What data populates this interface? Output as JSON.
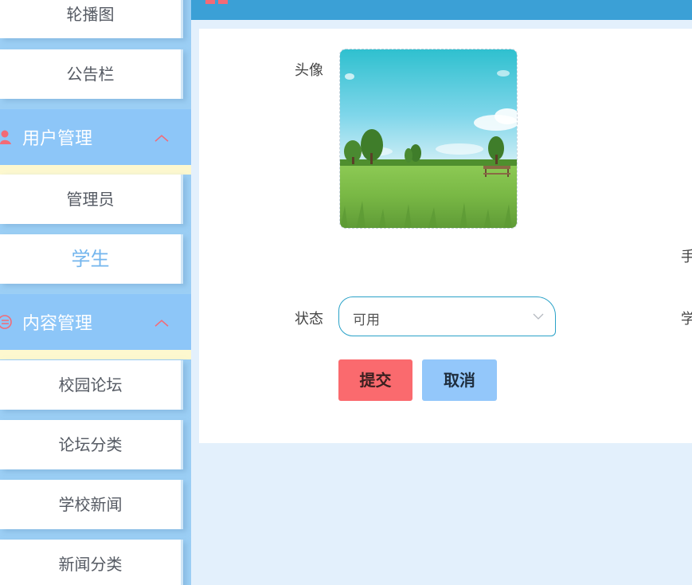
{
  "sidebar": {
    "items_top": [
      {
        "label": "轮播图"
      },
      {
        "label": "公告栏"
      }
    ],
    "group_user": {
      "label": "用户管理",
      "icon": "user-icon",
      "items": [
        {
          "label": "管理员"
        },
        {
          "label": "学生"
        }
      ]
    },
    "group_content": {
      "label": "内容管理",
      "icon": "list-icon",
      "items": [
        {
          "label": "校园论坛"
        },
        {
          "label": "论坛分类"
        },
        {
          "label": "学校新闻"
        },
        {
          "label": "新闻分类"
        }
      ]
    },
    "active_item": "学生"
  },
  "form": {
    "avatar_label": "头像",
    "status_label": "状态",
    "status_value": "可用",
    "right_label_1": "手",
    "right_label_2": "学",
    "submit_label": "提交",
    "cancel_label": "取消"
  },
  "colors": {
    "topbar": "#3ba0d6",
    "sidebar": "#9ccff5",
    "group_head": "#8dc6f8",
    "submit": "#fa6a6e",
    "cancel": "#93c7fa",
    "select_border": "#2aa2c8"
  }
}
